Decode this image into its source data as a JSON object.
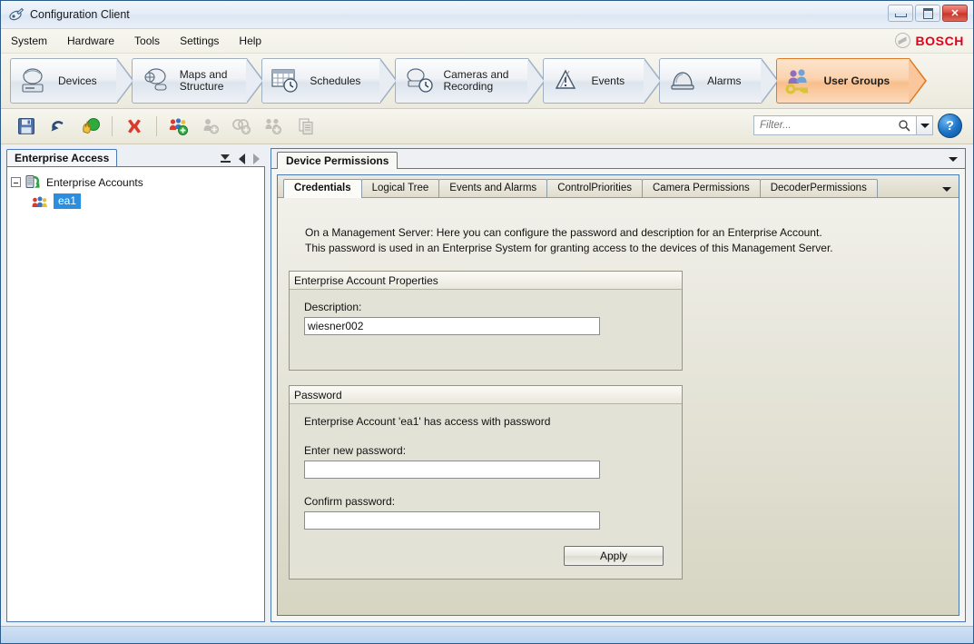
{
  "window": {
    "title": "Configuration Client",
    "app_icon": "configuration-client-icon",
    "minimize_label": "Minimize",
    "maximize_label": "Maximize",
    "close_label": "✕"
  },
  "brand": {
    "name": "BOSCH"
  },
  "menu": {
    "items": [
      "System",
      "Hardware",
      "Tools",
      "Settings",
      "Help"
    ]
  },
  "ribbon": {
    "tabs": [
      {
        "label": "Devices",
        "icon": "camera-device-icon",
        "active": false
      },
      {
        "label": "Maps and\nStructure",
        "icon": "maps-structure-icon",
        "active": false
      },
      {
        "label": "Schedules",
        "icon": "schedules-calendar-clock-icon",
        "active": false
      },
      {
        "label": "Cameras and\nRecording",
        "icon": "cameras-recording-icon",
        "active": false
      },
      {
        "label": "Events",
        "icon": "events-warning-icon",
        "active": false
      },
      {
        "label": "Alarms",
        "icon": "alarms-siren-icon",
        "active": false
      },
      {
        "label": "User Groups",
        "icon": "user-groups-key-icon",
        "active": true
      }
    ]
  },
  "toolbar": {
    "buttons": [
      {
        "name": "save-icon",
        "title": "Save",
        "enabled": true
      },
      {
        "name": "undo-icon",
        "title": "Undo",
        "enabled": true
      },
      {
        "name": "activate-configuration-icon",
        "title": "Activate Configuration",
        "enabled": true
      },
      {
        "name": "delete-icon",
        "title": "Delete",
        "enabled": true
      },
      {
        "name": "add-user-group-icon",
        "title": "Add User Group",
        "enabled": true
      },
      {
        "name": "add-user-icon",
        "title": "Add User",
        "enabled": false
      },
      {
        "name": "add-dual-authorization-group-icon",
        "title": "Add Dual Authorization Group",
        "enabled": false
      },
      {
        "name": "add-user-pair-icon",
        "title": "Add User Pair",
        "enabled": false
      },
      {
        "name": "copy-icon",
        "title": "Copy",
        "enabled": false
      }
    ],
    "filter": {
      "placeholder": "Filter...",
      "value": ""
    },
    "help_label": "?"
  },
  "left_panel": {
    "tab_label": "Enterprise Access",
    "tools": [
      "collapse-all-icon",
      "nav-back-icon",
      "nav-forward-icon"
    ],
    "tree": {
      "root": {
        "label": "Enterprise Accounts",
        "icon": "enterprise-accounts-icon",
        "expanded": true
      },
      "children": [
        {
          "label": "ea1",
          "icon": "user-group-icon",
          "selected": true
        }
      ]
    }
  },
  "right_panel": {
    "outer_tab": "Device Permissions",
    "inner_tabs": [
      {
        "label": "Credentials",
        "active": true
      },
      {
        "label": "Logical Tree",
        "active": false
      },
      {
        "label": "Events and Alarms",
        "active": false
      },
      {
        "label": "ControlPriorities",
        "active": false
      },
      {
        "label": "Camera Permissions",
        "active": false
      },
      {
        "label": "DecoderPermissions",
        "active": false
      }
    ],
    "description_line1": "On a Management Server: Here you can configure the password and description for an Enterprise Account.",
    "description_line2": "This password is used in an Enterprise System for granting access to the devices of this Management Server.",
    "account_properties": {
      "title": "Enterprise Account Properties",
      "description_label": "Description:",
      "description_value": "wiesner002"
    },
    "password_section": {
      "title": "Password",
      "info": "Enterprise Account 'ea1' has access with password",
      "new_password_label": "Enter new password:",
      "new_password_value": "",
      "confirm_password_label": "Confirm password:",
      "confirm_password_value": "",
      "apply_label": "Apply"
    }
  },
  "colors": {
    "accent_orange": "#e07a24",
    "brand_red": "#e2001a",
    "selection_blue": "#2a8fe0",
    "panel_border": "#4a79b5"
  }
}
